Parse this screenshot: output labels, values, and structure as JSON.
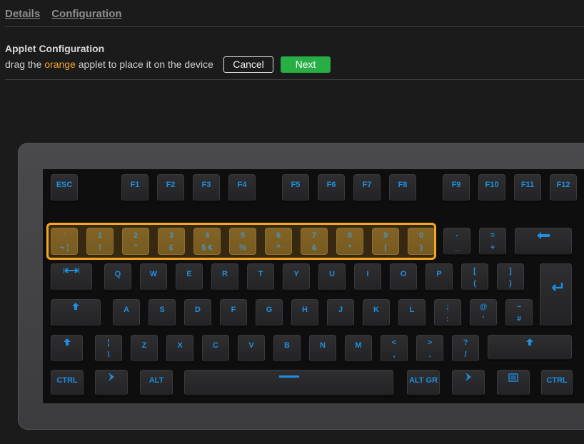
{
  "tabs": [
    {
      "label": "Details"
    },
    {
      "label": "Configuration"
    }
  ],
  "applet": {
    "title": "Applet Configuration",
    "desc_before": "drag the ",
    "desc_highlight": "orange",
    "desc_after": " applet to place it on the device",
    "cancel_label": "Cancel",
    "next_label": "Next"
  },
  "colors": {
    "accent_orange": "#f5a623",
    "next_green": "#27ae45",
    "key_legend_blue": "#1e8fe0"
  },
  "keyboard": {
    "fn_row": [
      "ESC",
      "F1",
      "F2",
      "F3",
      "F4",
      "F5",
      "F6",
      "F7",
      "F8",
      "F9",
      "F10",
      "F11",
      "F12"
    ],
    "number_row": [
      {
        "top": "`",
        "bot": "¬ ¦"
      },
      {
        "top": "1",
        "bot": "!"
      },
      {
        "top": "2",
        "bot": "\""
      },
      {
        "top": "3",
        "bot": "£"
      },
      {
        "top": "4",
        "bot": "$ €"
      },
      {
        "top": "5",
        "bot": "%"
      },
      {
        "top": "6",
        "bot": "^"
      },
      {
        "top": "7",
        "bot": "&"
      },
      {
        "top": "8",
        "bot": "*"
      },
      {
        "top": "9",
        "bot": "("
      },
      {
        "top": "0",
        "bot": ")"
      },
      {
        "top": "-",
        "bot": "_"
      },
      {
        "top": "=",
        "bot": "+"
      }
    ],
    "row_q": [
      "Q",
      "W",
      "E",
      "R",
      "T",
      "Y",
      "U",
      "I",
      "O",
      "P"
    ],
    "row_q_extra": [
      {
        "top": "[",
        "bot": "("
      },
      {
        "top": "]",
        "bot": ")"
      }
    ],
    "row_a": [
      "A",
      "S",
      "D",
      "F",
      "G",
      "H",
      "J",
      "K",
      "L"
    ],
    "row_a_extra": [
      {
        "top": ";",
        "bot": ":"
      },
      {
        "top": "@",
        "bot": "'"
      },
      {
        "top": "~",
        "bot": "#"
      }
    ],
    "row_z_pre": {
      "top": "¦",
      "bot": "\\"
    },
    "row_z": [
      "Z",
      "X",
      "C",
      "V",
      "B",
      "N",
      "M"
    ],
    "row_z_extra": [
      {
        "top": "<",
        "bot": ","
      },
      {
        "top": ">",
        "bot": "."
      },
      {
        "top": "?",
        "bot": "/"
      }
    ],
    "ctrl_left": "CTRL",
    "alt_left": "ALT",
    "alt_gr": "ALT GR",
    "ctrl_right": "CTRL"
  }
}
